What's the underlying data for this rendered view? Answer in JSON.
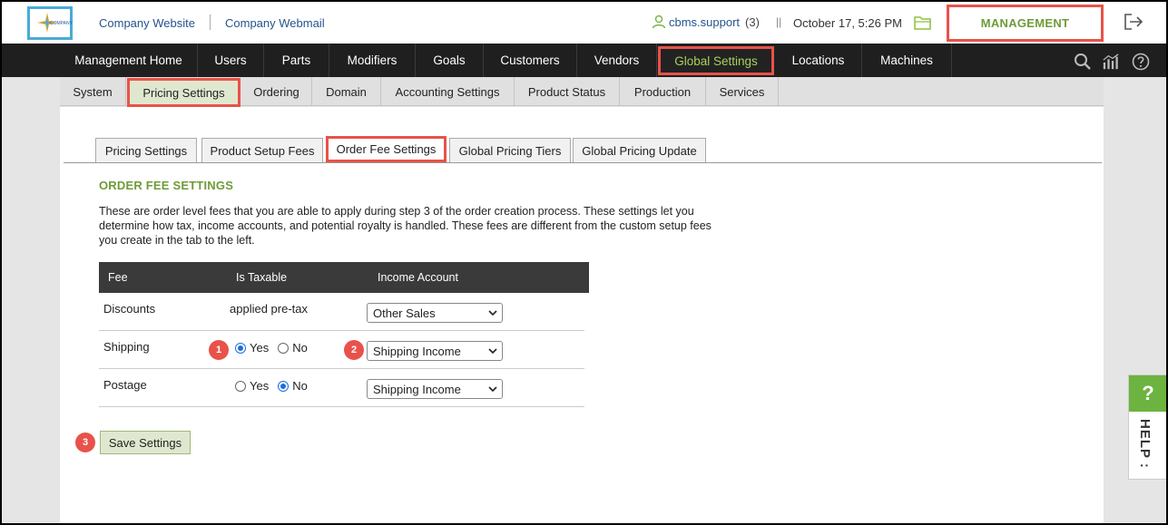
{
  "header": {
    "logo_text": "COMPANY",
    "links": [
      "Company Website",
      "Company Webmail"
    ],
    "user": "cbms.support",
    "user_count": "(3)",
    "datetime": "October 17, 5:26 PM",
    "management_label": "MANAGEMENT"
  },
  "mainnav": {
    "items": [
      "Management Home",
      "Users",
      "Parts",
      "Modifiers",
      "Goals",
      "Customers",
      "Vendors",
      "Global Settings",
      "Locations",
      "Machines"
    ],
    "active": "Global Settings"
  },
  "subnav": {
    "items": [
      "System",
      "Pricing Settings",
      "Ordering",
      "Domain",
      "Accounting Settings",
      "Product Status",
      "Production",
      "Services"
    ],
    "active": "Pricing Settings"
  },
  "tabs": {
    "items": [
      "Pricing Settings",
      "Product Setup Fees",
      "Order Fee Settings",
      "Global Pricing Tiers",
      "Global Pricing Update"
    ],
    "active": "Order Fee Settings"
  },
  "section": {
    "title": "ORDER FEE SETTINGS",
    "description": "These are order level fees that you are able to apply during step 3 of the order creation process. These settings let you determine how tax, income accounts, and potential royalty is handled. These fees are different from the custom setup fees you create in the tab to the left."
  },
  "table": {
    "headers": [
      "Fee",
      "Is Taxable",
      "Income Account"
    ],
    "rows": [
      {
        "fee": "Discounts",
        "taxable_text": "applied pre-tax",
        "account": "Other Sales"
      },
      {
        "fee": "Shipping",
        "taxable": "Yes",
        "yes_label": "Yes",
        "no_label": "No",
        "account": "Shipping Income"
      },
      {
        "fee": "Postage",
        "taxable": "No",
        "yes_label": "Yes",
        "no_label": "No",
        "account": "Shipping Income"
      }
    ]
  },
  "badges": [
    "1",
    "2",
    "3"
  ],
  "save_label": "Save Settings",
  "help": {
    "q": "?",
    "label": "HELP :"
  },
  "colors": {
    "accent_green": "#6f9b38",
    "highlight_red": "#e8524a",
    "nav_dark": "#1f1f1f"
  }
}
